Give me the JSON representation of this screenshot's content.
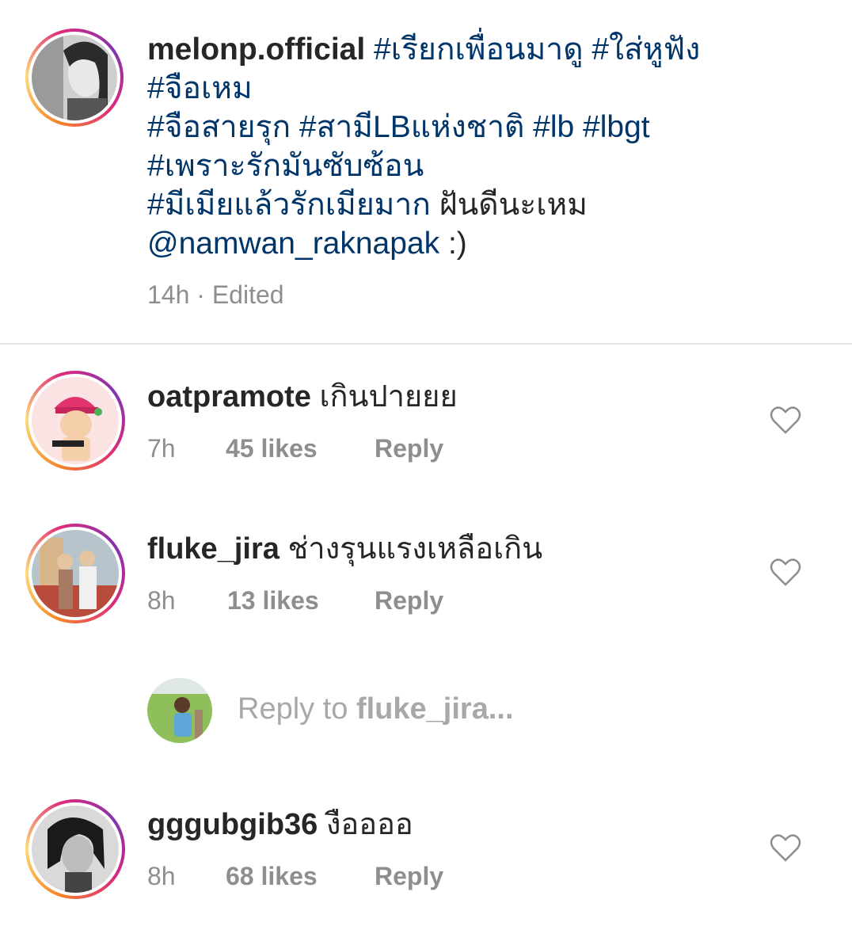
{
  "post": {
    "username": "melonp.official",
    "caption_lines": [
      [
        {
          "t": "tag",
          "v": " #เรียกเพื่อนมาดู #ใส่หูฟัง"
        }
      ],
      [
        {
          "t": "tag",
          "v": "#จือเหม"
        }
      ],
      [
        {
          "t": "tag",
          "v": "#จือสายรุก #สามีLBแห่งชาติ #lb #lbgt"
        }
      ],
      [
        {
          "t": "tag",
          "v": "#เพราะรักมันซับซ้อน"
        }
      ],
      [
        {
          "t": "tag",
          "v": "#มีเมียแล้วรักเมียมาก"
        },
        {
          "t": "plain",
          "v": " ฝันดีนะเหม"
        }
      ],
      [
        {
          "t": "tag",
          "v": "@namwan_raknapak"
        },
        {
          "t": "plain",
          "v": " :)"
        }
      ]
    ],
    "time": "14h",
    "separator": "·",
    "edited": "Edited"
  },
  "comments": [
    {
      "username": "oatpramote",
      "text": "เกินปายยย",
      "time": "7h",
      "likes": "45 likes",
      "reply": "Reply"
    },
    {
      "username": "fluke_jira",
      "text": "ช่างรุนแรงเหลือเกิน",
      "time": "8h",
      "likes": "13 likes",
      "reply": "Reply"
    },
    {
      "username": "gggubgib36",
      "text": "งืออออ",
      "time": "8h",
      "likes": "68 likes",
      "reply": "Reply"
    }
  ],
  "reply_input": {
    "prefix": "Reply to ",
    "target": "fluke_jira..."
  },
  "icons": {
    "like": "heart-outline-icon"
  },
  "colors": {
    "hashtag": "#003569",
    "meta": "#8e8e8e",
    "divider": "#e6e6e6"
  }
}
